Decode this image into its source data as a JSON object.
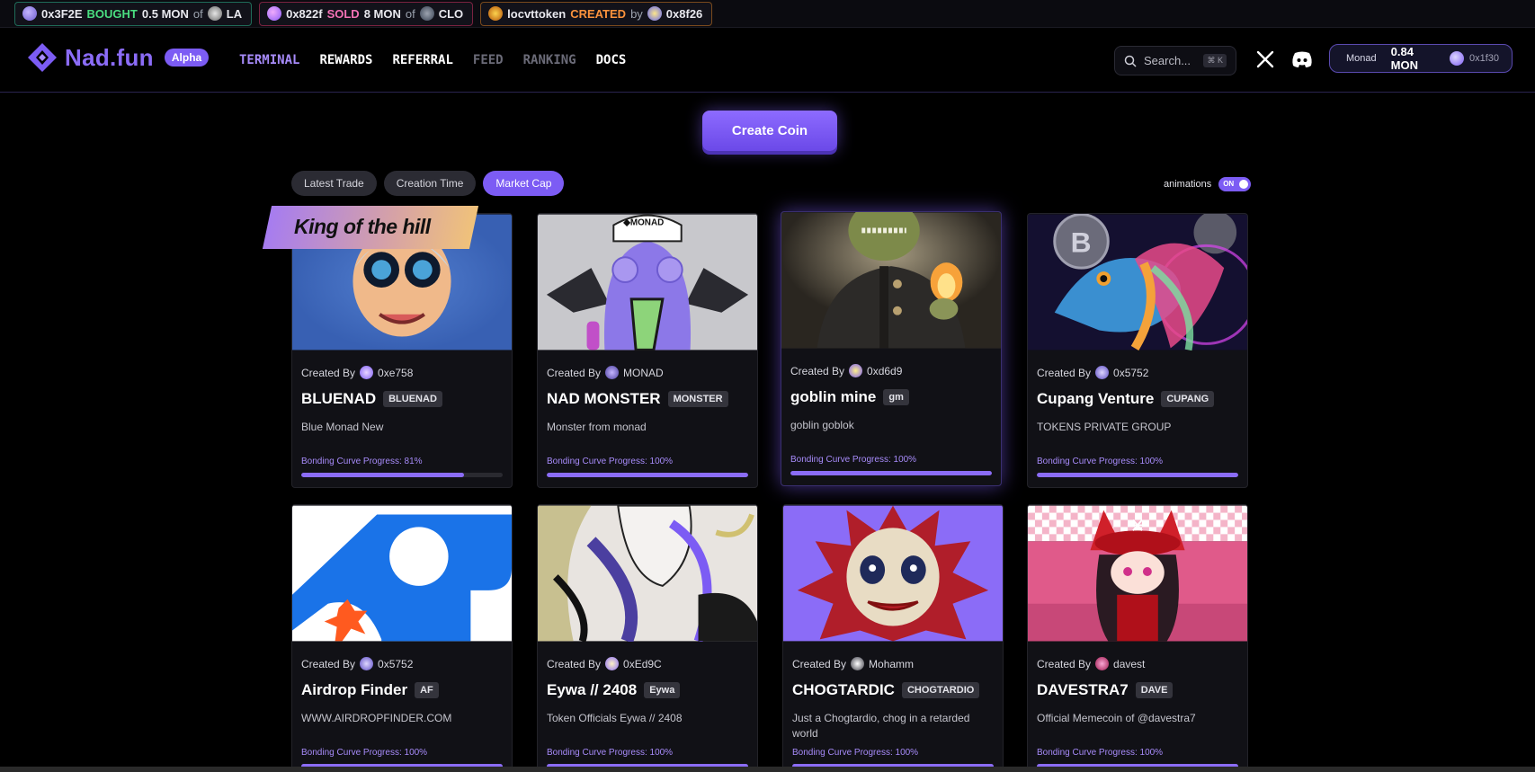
{
  "ticker": [
    {
      "user": "0x3F2E",
      "action": "BOUGHT",
      "amount": "0.5 MON",
      "prep": "of",
      "token": "LA",
      "kind": "buy"
    },
    {
      "user": "0x822f",
      "action": "SOLD",
      "amount": "8 MON",
      "prep": "of",
      "token": "CLO",
      "kind": "sell"
    },
    {
      "user": "locvttoken",
      "action": "CREATED",
      "amount": "",
      "prep": "by",
      "token": "0x8f26",
      "kind": "create"
    }
  ],
  "brand": {
    "name": "Nad.fun",
    "badge": "Alpha"
  },
  "nav": [
    {
      "label": "TERMINAL",
      "state": "active"
    },
    {
      "label": "REWARDS",
      "state": "white"
    },
    {
      "label": "REFERRAL",
      "state": "white"
    },
    {
      "label": "FEED",
      "state": "dim"
    },
    {
      "label": "RANKING",
      "state": "dim"
    },
    {
      "label": "DOCS",
      "state": "white"
    }
  ],
  "search": {
    "placeholder": "Search...",
    "shortcut": "⌘ K"
  },
  "wallet": {
    "network": "Monad",
    "balance": "0.84 MON",
    "address": "0x1f30"
  },
  "create_label": "Create Coin",
  "sort": [
    {
      "label": "Latest Trade",
      "active": false
    },
    {
      "label": "Creation Time",
      "active": false
    },
    {
      "label": "Market Cap",
      "active": true
    }
  ],
  "animations": {
    "label": "animations",
    "state": "ON"
  },
  "king_label": "King of the hill",
  "created_by": "Created By",
  "tokens": [
    {
      "creator": "0xe758",
      "name": "BLUENAD",
      "symbol": "BLUENAD",
      "desc": "Blue Monad New",
      "progress": "Bonding Curve Progress: 81%",
      "pct": 81
    },
    {
      "creator": "MONAD",
      "name": "NAD MONSTER",
      "symbol": "MONSTER",
      "desc": "Monster from monad",
      "progress": "Bonding Curve Progress: 100%",
      "pct": 100
    },
    {
      "creator": "0xd6d9",
      "name": "goblin mine",
      "symbol": "gm",
      "desc": "goblin goblok",
      "progress": "Bonding Curve Progress: 100%",
      "pct": 100
    },
    {
      "creator": "0x5752",
      "name": "Cupang Venture",
      "symbol": "CUPANG",
      "desc": "TOKENS PRIVATE GROUP",
      "progress": "Bonding Curve Progress: 100%",
      "pct": 100
    },
    {
      "creator": "0x5752",
      "name": "Airdrop Finder",
      "symbol": "AF",
      "desc": "WWW.AIRDROPFINDER.COM",
      "progress": "Bonding Curve Progress: 100%",
      "pct": 100
    },
    {
      "creator": "0xEd9C",
      "name": "Eywa // 2408",
      "symbol": "Eywa",
      "desc": "Token Officials Eywa // 2408",
      "progress": "Bonding Curve Progress: 100%",
      "pct": 100
    },
    {
      "creator": "Mohamm",
      "name": "CHOGTARDIC",
      "symbol": "CHOGTARDIO",
      "desc": "Just a Chogtardio, chog in a retarded world",
      "progress": "Bonding Curve Progress: 100%",
      "pct": 100
    },
    {
      "creator": "davest",
      "name": "DAVESTRA7",
      "symbol": "DAVE",
      "desc": "Official Memecoin of @davestra7",
      "progress": "Bonding Curve Progress: 100%",
      "pct": 100
    }
  ]
}
